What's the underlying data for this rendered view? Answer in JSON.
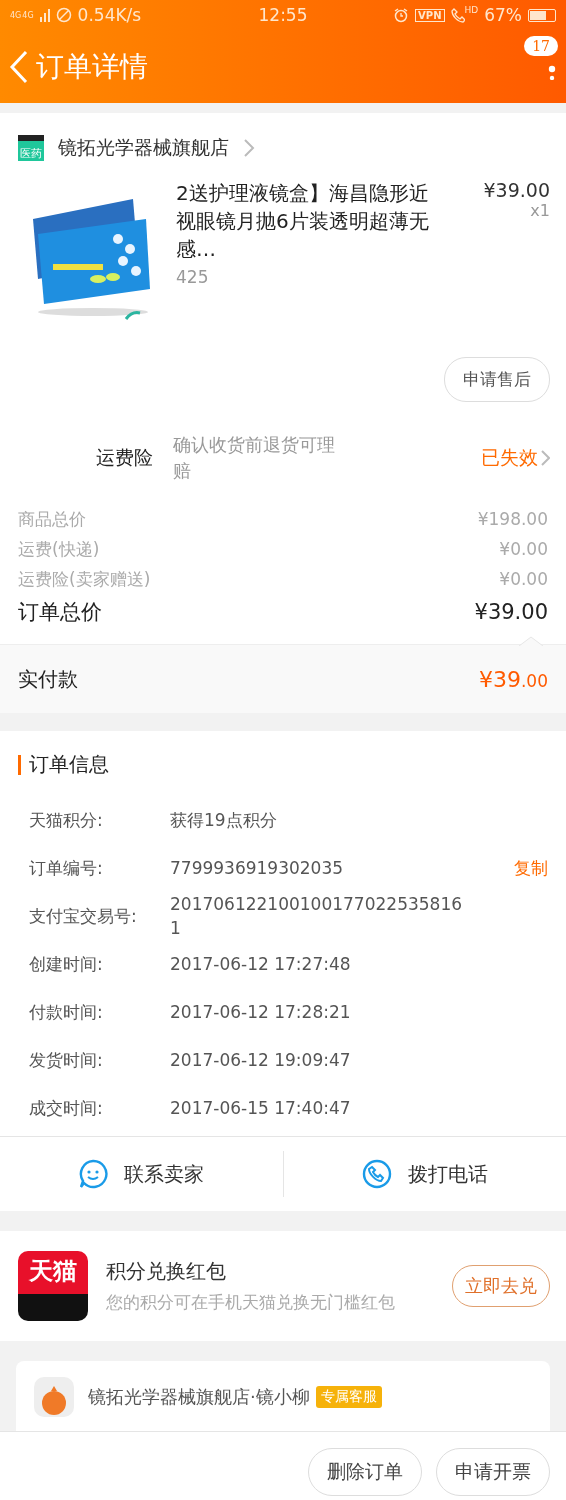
{
  "status_bar": {
    "network_labels": [
      "4G",
      "4G"
    ],
    "speed": "0.54K/s",
    "time": "12:55",
    "vpn": "VPN",
    "call_label": "HD",
    "battery": "67%"
  },
  "nav": {
    "title": "订单详情",
    "badge": "17"
  },
  "shop": {
    "name": "镜拓光学器械旗舰店",
    "badge": "医药",
    "product": {
      "title": "2送护理液镜盒】海昌隐形近视眼镜月抛6片装透明超薄无感…",
      "sku": "425",
      "price": "¥39.00",
      "quantity": "x1"
    },
    "after_sale_button": "申请售后"
  },
  "insurance": {
    "label": "运费险",
    "note": "确认收货前退货可理赔",
    "status": "已失效"
  },
  "summary": {
    "rows": [
      {
        "label": "商品总价",
        "value": "¥198.00",
        "kind": "minor"
      },
      {
        "label": "运费(快递)",
        "value": "¥0.00",
        "kind": "minor"
      },
      {
        "label": "运费险(卖家赠送)",
        "value": "¥0.00",
        "kind": "minor"
      },
      {
        "label": "订单总价",
        "value": "¥39.00",
        "kind": "total"
      }
    ],
    "paid_label": "实付款",
    "paid_integer": "¥39",
    "paid_fraction": ".00"
  },
  "order_info": {
    "title": "订单信息",
    "rows": [
      {
        "label": "天猫积分:",
        "value": "获得19点积分"
      },
      {
        "label": "订单编号:",
        "value": "7799936919302035",
        "action": "复制"
      },
      {
        "label": "支付宝交易号:",
        "value": "2017061221001001770225358161"
      },
      {
        "label": "创建时间:",
        "value": "2017-06-12 17:27:48"
      },
      {
        "label": "付款时间:",
        "value": "2017-06-12 17:28:21"
      },
      {
        "label": "发货时间:",
        "value": "2017-06-12 19:09:47"
      },
      {
        "label": "成交时间:",
        "value": "2017-06-15 17:40:47"
      }
    ]
  },
  "contact": [
    {
      "label": "联系卖家",
      "kind": "chat"
    },
    {
      "label": "拨打电话",
      "kind": "phone"
    }
  ],
  "promo": {
    "logo_text": "天猫",
    "title": "积分兑换红包",
    "subtitle": "您的积分可在手机天猫兑换无门槛红包",
    "button": "立即去兑"
  },
  "service": {
    "name": "镜拓光学器械旗舰店·镜小柳",
    "tag": "专属客服"
  },
  "bottom_buttons": [
    "删除订单",
    "申请开票"
  ]
}
